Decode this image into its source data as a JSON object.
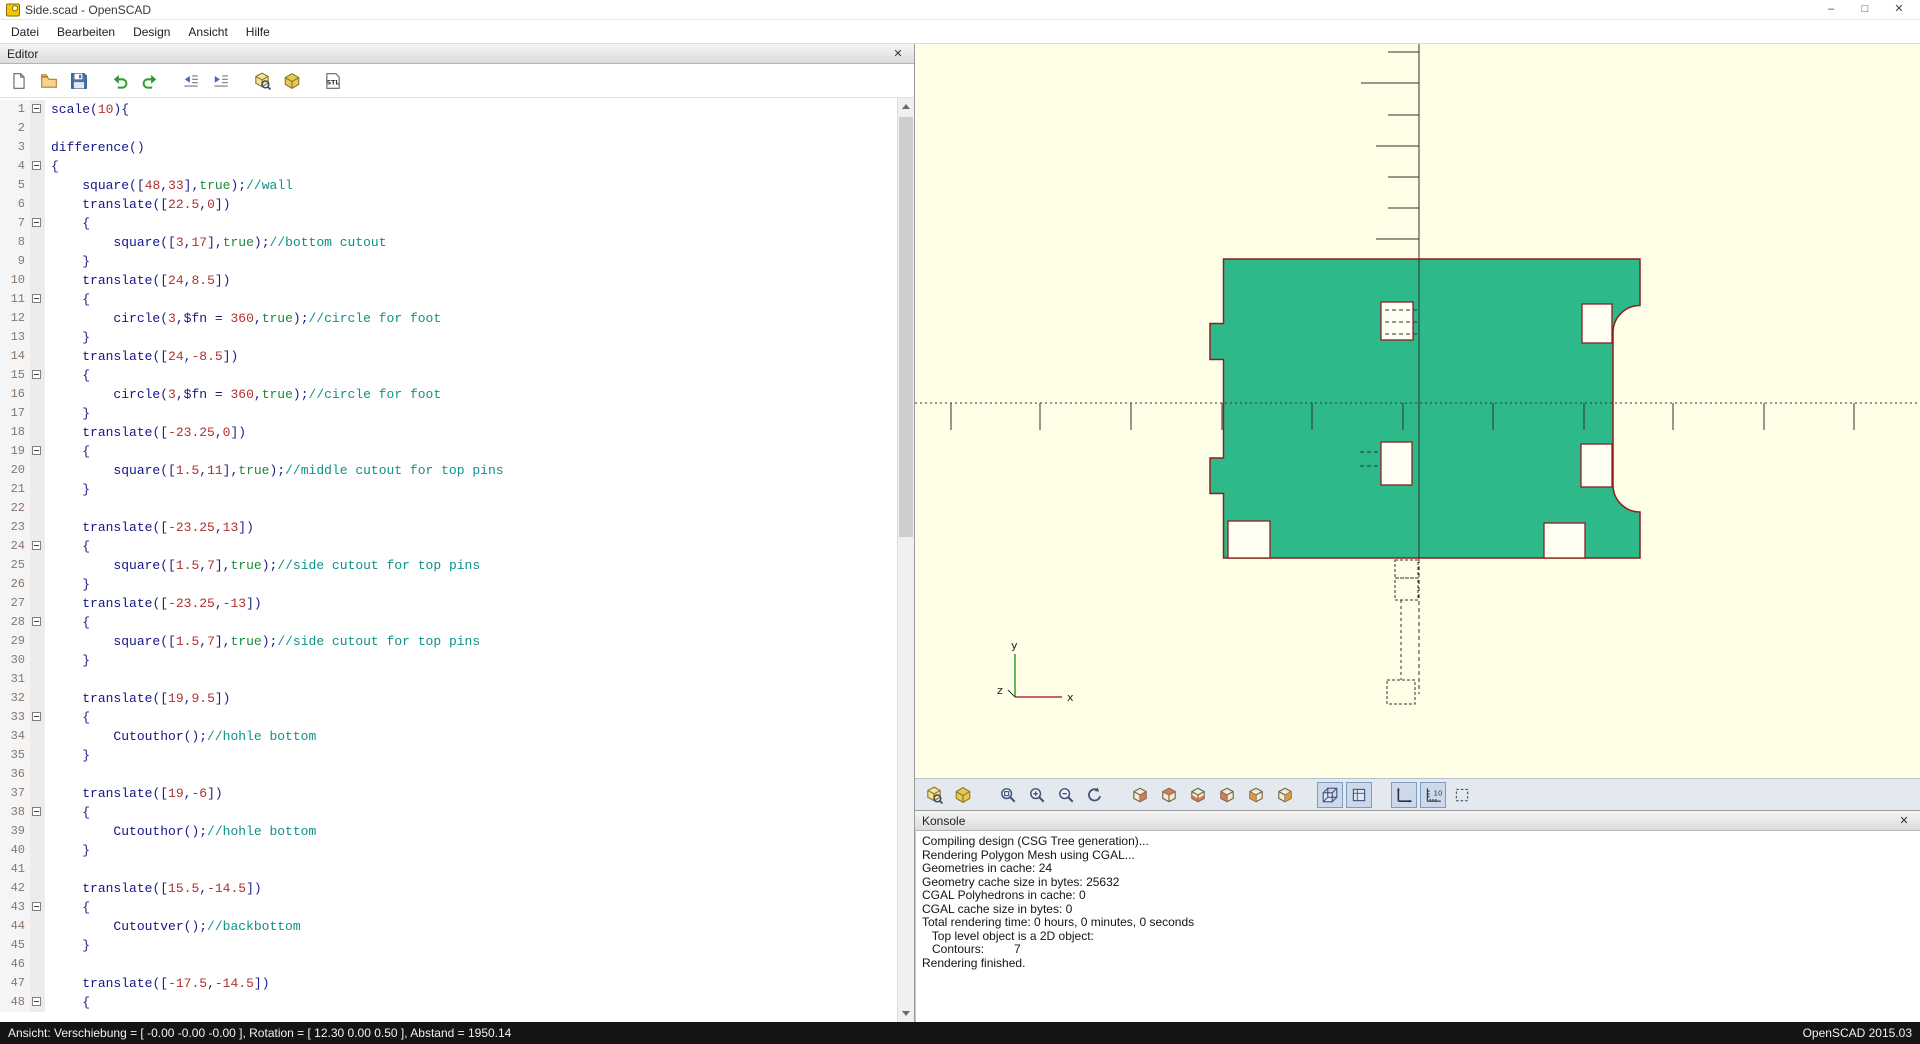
{
  "window": {
    "title": "Side.scad - OpenSCAD",
    "controls": {
      "minimize": "–",
      "maximize": "□",
      "close": "✕"
    }
  },
  "menu": {
    "items": [
      "Datei",
      "Bearbeiten",
      "Design",
      "Ansicht",
      "Hilfe"
    ]
  },
  "editor": {
    "panel_title": "Editor",
    "close_label": "✕",
    "toolbar": [
      {
        "name": "new-file",
        "icon": "new-file"
      },
      {
        "name": "open-file",
        "icon": "open-folder"
      },
      {
        "name": "save-file",
        "icon": "save"
      },
      {
        "name": "undo",
        "icon": "undo",
        "gap": true
      },
      {
        "name": "redo",
        "icon": "redo"
      },
      {
        "name": "unindent",
        "icon": "unindent",
        "gap": true
      },
      {
        "name": "indent",
        "icon": "indent"
      },
      {
        "name": "preview",
        "icon": "preview",
        "gap": true
      },
      {
        "name": "render",
        "icon": "render"
      },
      {
        "name": "export-stl",
        "icon": "stl",
        "gap": true
      }
    ],
    "code_lines": [
      "scale(10){",
      "",
      "difference()",
      "{",
      "\tsquare([48,33],true);//wall",
      "\ttranslate([22.5,0])",
      "\t{",
      "\t\tsquare([3,17],true);//bottom cutout",
      "\t}",
      "\ttranslate([24,8.5])",
      "\t{",
      "\t\tcircle(3,$fn = 360,true);//circle for foot",
      "\t}",
      "\ttranslate([24,-8.5])",
      "\t{",
      "\t\tcircle(3,$fn = 360,true);//circle for foot",
      "\t}",
      "\ttranslate([-23.25,0])",
      "\t{",
      "\t\tsquare([1.5,11],true);//middle cutout for top pins",
      "\t}",
      "",
      "\ttranslate([-23.25,13])",
      "\t{",
      "\t\tsquare([1.5,7],true);//side cutout for top pins",
      "\t}",
      "\ttranslate([-23.25,-13])",
      "\t{",
      "\t\tsquare([1.5,7],true);//side cutout for top pins",
      "\t}",
      "",
      "\ttranslate([19,9.5])",
      "\t{",
      "\t\tCutouthor();//hohle bottom",
      "\t}",
      "",
      "\ttranslate([19,-6])",
      "\t{",
      "\t\tCutouthor();//hohle bottom",
      "\t}",
      "",
      "\ttranslate([15.5,-14.5])",
      "\t{",
      "\t\tCutoutver();//backbottom",
      "\t}",
      "",
      "\ttranslate([-17.5,-14.5])",
      "\t{"
    ]
  },
  "viewport": {
    "bg_color": "#ffffe8",
    "shape_fill": "#2eb98b",
    "shape_stroke": "#8f1f1f",
    "cutout_fill": "#fffff4",
    "axis_x_color": "#b03030",
    "axis_y_color": "#2ca02c",
    "axis_labels": {
      "x": "x",
      "y": "y",
      "z": "z"
    }
  },
  "viewport_toolbar": {
    "buttons": [
      {
        "name": "preview",
        "icon": "preview"
      },
      {
        "name": "render",
        "icon": "render"
      },
      {
        "name": "zoom-all",
        "icon": "zoom-all",
        "gap": true
      },
      {
        "name": "zoom-in",
        "icon": "zoom-in"
      },
      {
        "name": "zoom-out",
        "icon": "zoom-out"
      },
      {
        "name": "reset-view",
        "icon": "reset-view"
      },
      {
        "name": "view-right",
        "icon": "view-right",
        "gap": true
      },
      {
        "name": "view-top",
        "icon": "view-top"
      },
      {
        "name": "view-bottom",
        "icon": "view-bottom"
      },
      {
        "name": "view-left",
        "icon": "view-left"
      },
      {
        "name": "view-front",
        "icon": "view-front"
      },
      {
        "name": "view-back",
        "icon": "view-back"
      },
      {
        "name": "view-perspective",
        "icon": "perspective",
        "gap": true,
        "active": true
      },
      {
        "name": "view-orthogonal",
        "icon": "orthogonal",
        "active": true
      },
      {
        "name": "show-axes",
        "icon": "show-axes",
        "gap": true,
        "active": true
      },
      {
        "name": "show-scale-markers",
        "icon": "scale-markers",
        "active": true
      },
      {
        "name": "show-edges",
        "icon": "show-edges"
      }
    ]
  },
  "console": {
    "panel_title": "Konsole",
    "close_label": "✕",
    "lines": [
      "Compiling design (CSG Tree generation)...",
      "Rendering Polygon Mesh using CGAL...",
      "Geometries in cache: 24",
      "Geometry cache size in bytes: 25632",
      "CGAL Polyhedrons in cache: 0",
      "CGAL cache size in bytes: 0",
      "Total rendering time: 0 hours, 0 minutes, 0 seconds",
      "   Top level object is a 2D object:",
      "   Contours:         7",
      "Rendering finished."
    ]
  },
  "statusbar": {
    "left": "Ansicht: Verschiebung = [ -0.00 -0.00 -0.00 ], Rotation = [ 12.30 0.00 0.50 ], Abstand = 1950.14",
    "right": "OpenSCAD 2015.03"
  }
}
